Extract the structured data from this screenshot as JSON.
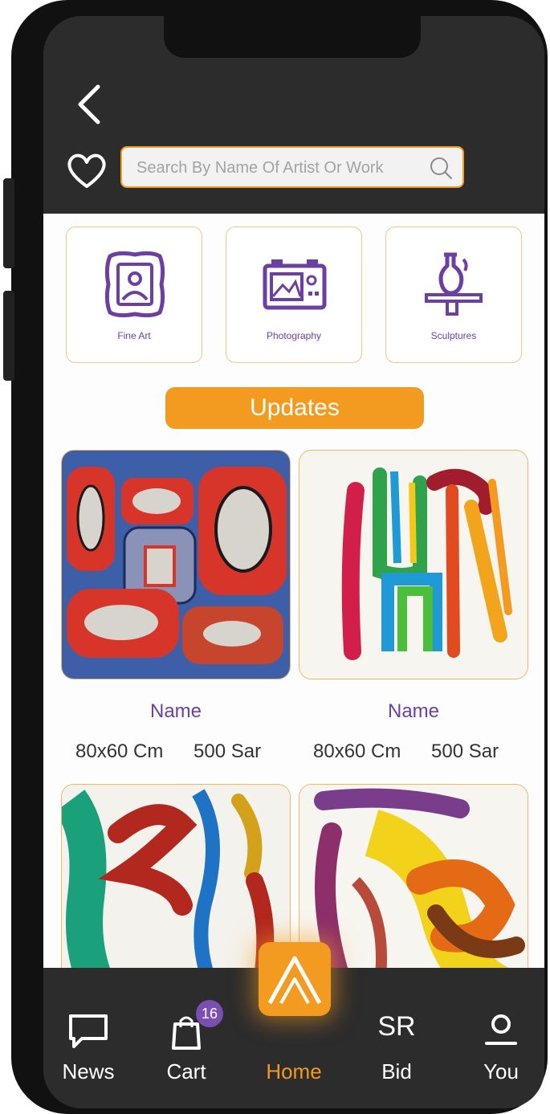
{
  "search": {
    "placeholder": "Search By Name Of Artist Or Work"
  },
  "categories": [
    {
      "label": "Fine Art",
      "icon": "framed-portrait-icon"
    },
    {
      "label": "Photography",
      "icon": "camera-icon"
    },
    {
      "label": "Sculptures",
      "icon": "vase-icon"
    }
  ],
  "section": {
    "title": "Updates"
  },
  "artworks": [
    {
      "name": "Name",
      "size": "80x60 Cm",
      "price": "500 Sar"
    },
    {
      "name": "Name",
      "size": "80x60 Cm",
      "price": "500 Sar"
    }
  ],
  "cart": {
    "badge": "16"
  },
  "tabs": [
    {
      "label": "News",
      "icon": "chat-bubble-icon"
    },
    {
      "label": "Cart",
      "icon": "shopping-bag-icon"
    },
    {
      "label": "Home",
      "icon": "logo-icon"
    },
    {
      "label": "Bid",
      "icon": "currency-sr-icon",
      "glyph": "SR"
    },
    {
      "label": "You",
      "icon": "user-icon"
    }
  ],
  "colors": {
    "accent": "#f39a21",
    "purple": "#6d3fa3",
    "dark": "#2c2c2c"
  }
}
